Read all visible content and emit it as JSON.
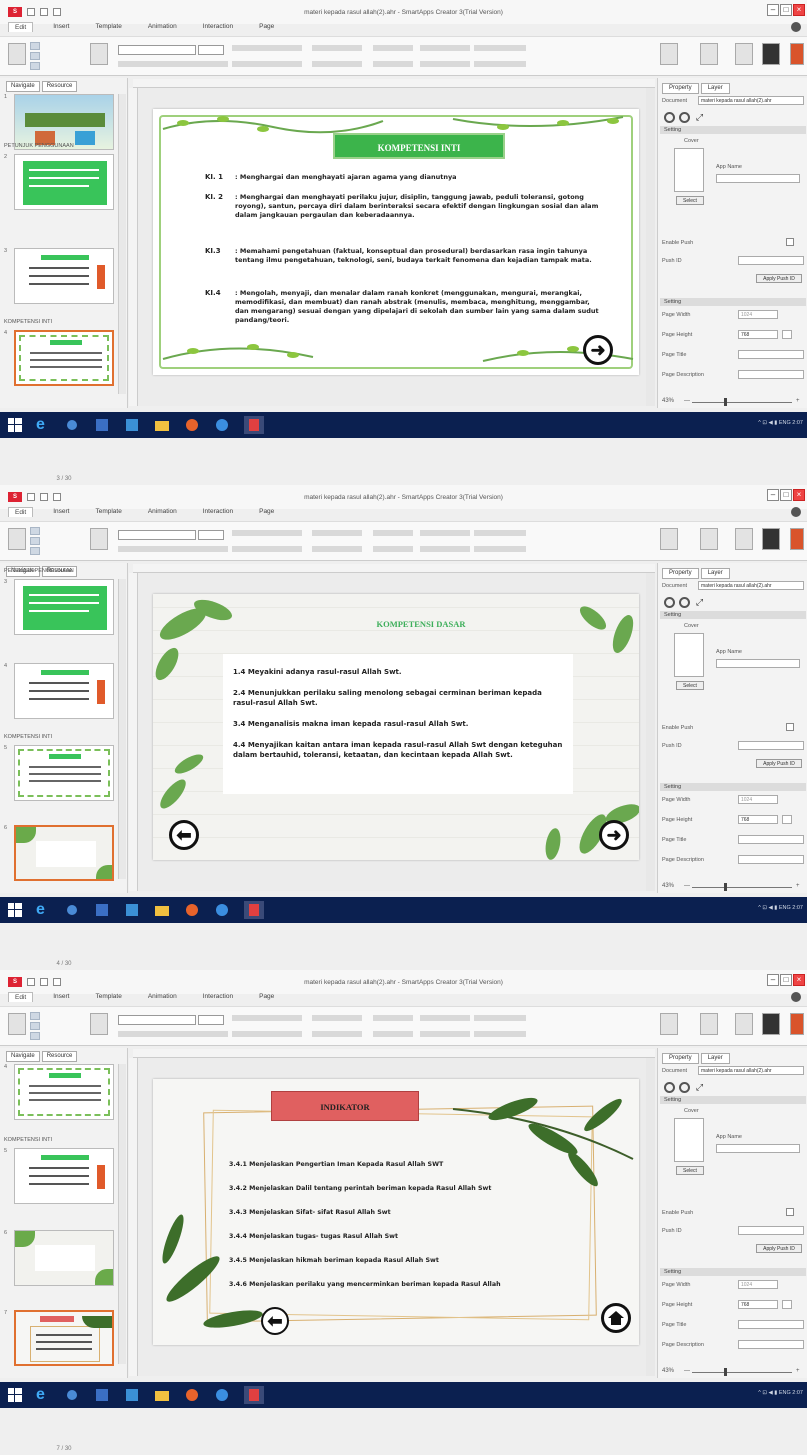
{
  "app": {
    "window_title": "materi kepada rasul allah(2).ahr - SmartApps Creator 3(Trial Version)",
    "tabs": [
      "Edit",
      "Insert",
      "Template",
      "Animation",
      "Interaction",
      "Page"
    ],
    "left_tabs": [
      "Navigate",
      "Resource"
    ],
    "right_tabs": [
      "Property",
      "Layer"
    ],
    "right_rows": {
      "document": "Document",
      "document_value": "materi kepada rasul allah(2).ahr",
      "setting": "Setting",
      "cover": "Cover",
      "app_name": "App Name",
      "select": "Select",
      "enable_push": "Enable Push",
      "push_id": "Push ID",
      "apply_push": "Apply Push ID",
      "page_setting": "Setting",
      "page_width": "Page Width",
      "page_width_value": "1024",
      "page_height": "Page Height",
      "page_height_value": "768",
      "page_title": "Page Title",
      "page_desc": "Page Description"
    },
    "zoom": "43%",
    "section_headers": [
      "PETUNJUK PENGGUNAAN",
      "KOMPETENSI INTI",
      "KOMPETENSI DASAR",
      "INDIKATOR"
    ],
    "taskbar_time": "2:07"
  },
  "screens": [
    {
      "page_count": "3 / 30",
      "thumbnails": [
        "1",
        "2",
        "3",
        "4"
      ],
      "slide": {
        "title": "KOMPETENSI INTI",
        "items": [
          {
            "code": "KI. 1",
            "text": ": Menghargai dan menghayati ajaran agama yang dianutnya"
          },
          {
            "code": "KI. 2",
            "text": ": Menghargai dan menghayati perilaku jujur, disiplin, tanggung jawab, peduli toleransi, gotong royong), santun, percaya diri dalam berinteraksi secara efektif dengan lingkungan sosial dan alam dalam jangkauan pergaulan dan keberadaannya."
          },
          {
            "code": "KI.3",
            "text": ": Memahami pengetahuan (faktual, konseptual dan prosedural) berdasarkan rasa ingin tahunya tentang ilmu pengetahuan, teknologi, seni, budaya terkait fenomena dan kejadian tampak mata."
          },
          {
            "code": "KI.4",
            "text": ": Mengolah, menyaji, dan menalar dalam ranah konkret (menggunakan, mengurai, merangkai, memodifikasi, dan membuat) dan ranah abstrak (menulis, membaca, menghitung, menggambar, dan mengarang) sesuai dengan yang dipelajari di sekolah dan sumber lain yang sama dalam sudut pandang/teori."
          }
        ],
        "next_icon": "arrow-right-icon"
      }
    },
    {
      "page_count": "4 / 30",
      "thumbnails": [
        "3",
        "4",
        "5",
        "6"
      ],
      "slide": {
        "title": "KOMPETENSI DASAR",
        "items": [
          "1.4 Meyakini adanya rasul-rasul Allah Swt.",
          "2.4 Menunjukkan perilaku saling menolong sebagai cerminan beriman kepada rasul-rasul Allah Swt.",
          "3.4 Menganalisis makna iman kepada rasul-rasul Allah Swt.",
          "4.4 Menyajikan kaitan antara iman kepada rasul-rasul Allah Swt dengan keteguhan dalam bertauhid, toleransi, ketaatan, dan kecintaan kepada Allah Swt."
        ],
        "prev_icon": "arrow-left-icon",
        "next_icon": "arrow-right-icon"
      }
    },
    {
      "page_count": "7 / 30",
      "thumbnails": [
        "4",
        "5",
        "6",
        "7"
      ],
      "slide": {
        "title": "INDIKATOR",
        "items": [
          "3.4.1 Menjelaskan Pengertian Iman Kepada Rasul Allah SWT",
          "3.4.2 Menjelaskan Dalil tentang perintah beriman kepada Rasul Allah Swt",
          "3.4.3 Menjelaskan Sifat- sifat Rasul Allah Swt",
          "3.4.4 Menjelaskan tugas- tugas Rasul Allah Swt",
          "3.4.5 Menjelaskan hikmah beriman kepada Rasul Allah Swt",
          "3.4.6 Menjelaskan perilaku yang mencerminkan beriman kepada Rasul Allah"
        ],
        "prev_icon": "arrow-left-icon",
        "home_icon": "home-icon"
      }
    }
  ],
  "colors": {
    "ki_title_bg": "#3cb44b",
    "kd_title": "#3cae5a",
    "ind_title_bg": "#e06060",
    "thumb_green": "#39c45a",
    "taskbar": "#0b2050",
    "close_red": "#e44444"
  }
}
